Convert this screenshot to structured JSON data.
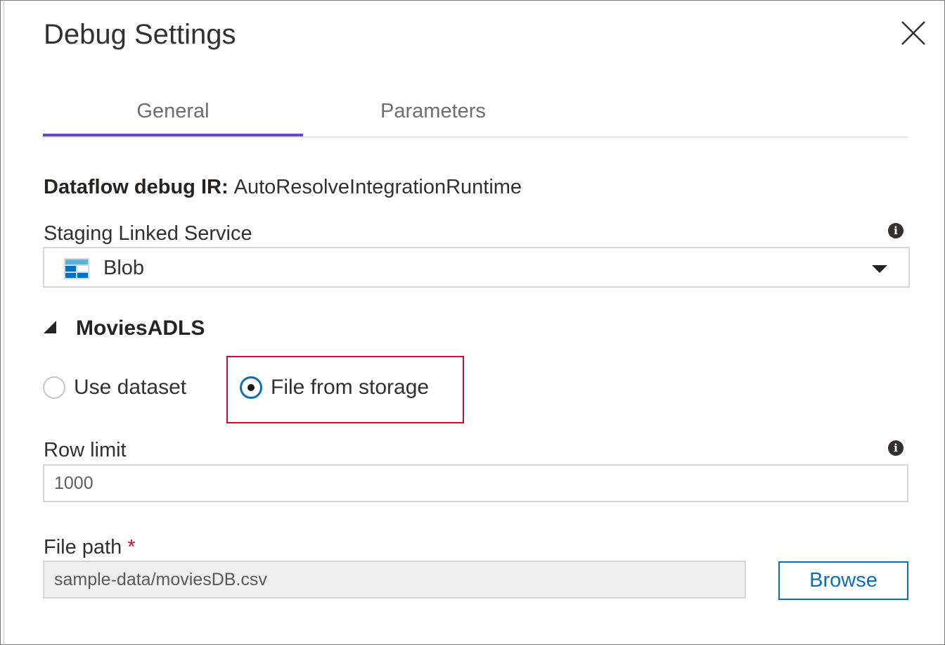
{
  "dialog": {
    "title": "Debug Settings",
    "close_icon": "close-icon"
  },
  "tabs": [
    {
      "label": "General",
      "active": true
    },
    {
      "label": "Parameters",
      "active": false
    }
  ],
  "ir": {
    "label": "Dataflow debug IR:",
    "value": "AutoResolveIntegrationRuntime"
  },
  "staging": {
    "label": "Staging Linked Service",
    "info_icon": "info-icon",
    "selected": "Blob",
    "icon": "blob-storage-icon",
    "dropdown_icon": "chevron-down-icon"
  },
  "section": {
    "title": "MoviesADLS",
    "expanded": true
  },
  "source_options": [
    {
      "label": "Use dataset",
      "checked": false
    },
    {
      "label": "File from storage",
      "checked": true
    }
  ],
  "row_limit": {
    "label": "Row limit",
    "value": "1000",
    "info_icon": "info-icon"
  },
  "file_path": {
    "label": "File path",
    "required_mark": "*",
    "value": "sample-data/moviesDB.csv",
    "browse_label": "Browse"
  },
  "colors": {
    "accent": "#6b46c1",
    "primary": "#0f6cbd",
    "required": "#c8102e",
    "highlight": "#c8102e"
  }
}
